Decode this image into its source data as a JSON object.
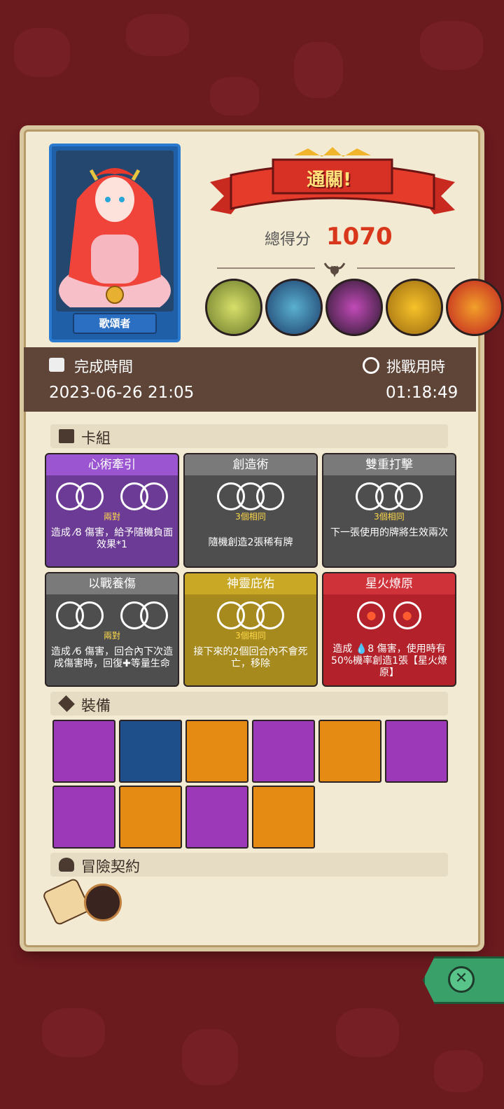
{
  "colors": {
    "background": "#6b1a1e",
    "panel": "#f3ead3",
    "score": "#d9371c",
    "time_band": "#5e4538",
    "purple": "#6b3b95",
    "gray": "#4e4e4e",
    "gold": "#a68a1e",
    "red": "#b3222a",
    "equip_purple": "#9b39b8",
    "equip_orange": "#e58a12",
    "equip_blue": "#1f4f8a"
  },
  "hero": {
    "name": "歌頌者"
  },
  "result": {
    "banner": "通關!",
    "score_label": "總得分",
    "score": "1070"
  },
  "bosses": [
    "skeleton-dragon-icon",
    "spider-king-icon",
    "dark-knight-icon",
    "pumpkin-icon",
    "fire-demon-icon"
  ],
  "times": {
    "finish_label": "完成時間",
    "finish_value": "2023-06-26 21:05",
    "challenge_label": "挑戰用時",
    "challenge_value": "01:18:49"
  },
  "deck": {
    "title": "卡組",
    "cards": [
      {
        "name": "心術牽引",
        "sub": "兩對",
        "desc": "造成 ⁄8 傷害，給予隨機負面效果*1",
        "style": "purple"
      },
      {
        "name": "創造術",
        "sub": "3個相同",
        "desc": "隨機創造2張稀有牌",
        "style": "gray"
      },
      {
        "name": "雙重打擊",
        "sub": "3個相同",
        "desc": "下一張使用的牌將生效兩次",
        "style": "gray"
      },
      {
        "name": "以戰養傷",
        "sub": "兩對",
        "desc": "造成 ⁄6 傷害，回合內下次造成傷害時，回復✚等量生命",
        "style": "gray"
      },
      {
        "name": "神靈庇佑",
        "sub": "3個相同",
        "desc": "接下來的2個回合內不會死亡，移除",
        "style": "gold"
      },
      {
        "name": "星火燎原",
        "sub": "",
        "desc": "造成 💧8 傷害，使用時有50%機率創造1張【星火燎原】",
        "style": "red"
      }
    ]
  },
  "equipment": {
    "title": "裝備",
    "items": [
      {
        "icon": "dragon-sword-icon",
        "bg": "purple"
      },
      {
        "icon": "crystal-ball-icon",
        "bg": "blue"
      },
      {
        "icon": "crown-icon",
        "bg": "orange"
      },
      {
        "icon": "spiked-dice-icon",
        "bg": "purple"
      },
      {
        "icon": "plague-mask-icon",
        "bg": "orange"
      },
      {
        "icon": "heart-gem-icon",
        "bg": "purple"
      },
      {
        "icon": "torn-cloth-icon",
        "bg": "purple"
      },
      {
        "icon": "dark-armor-icon",
        "bg": "orange"
      },
      {
        "icon": "chest-armor-icon",
        "bg": "purple"
      },
      {
        "icon": "horn-icon",
        "bg": "orange"
      }
    ]
  },
  "contracts": {
    "title": "冒險契約",
    "items": [
      "scroll-icon",
      "pipe-icon"
    ]
  }
}
